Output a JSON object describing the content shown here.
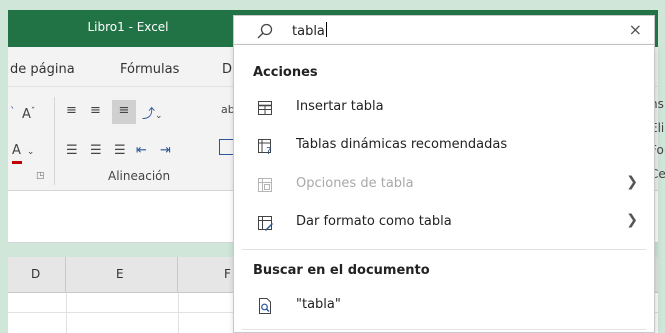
{
  "window": {
    "title": "Libro1  -  Excel"
  },
  "ribbon": {
    "tabs": [
      "de página",
      "Fórmulas",
      "D"
    ],
    "alignment_group_label": "Alineación",
    "right_cut_texts": [
      "ns",
      "Elir",
      "For",
      "Ce"
    ],
    "wrap_text_fragment": "ab"
  },
  "columns": [
    "D",
    "E",
    "F"
  ],
  "search": {
    "value": "tabla",
    "close_glyph": "×",
    "sections": {
      "actions_title": "Acciones",
      "document_title": "Buscar en el documento"
    },
    "actions": [
      {
        "label": "Insertar tabla",
        "icon": "insert-table-icon",
        "enabled": true,
        "submenu": false
      },
      {
        "label": "Tablas dinámicas recomendadas",
        "icon": "recommended-pivot-icon",
        "enabled": true,
        "submenu": false
      },
      {
        "label": "Opciones de tabla",
        "icon": "table-options-icon",
        "enabled": false,
        "submenu": true
      },
      {
        "label": "Dar formato como tabla",
        "icon": "format-as-table-icon",
        "enabled": true,
        "submenu": true
      }
    ],
    "document_results": [
      {
        "label": "\"tabla\"",
        "icon": "search-document-icon"
      }
    ]
  },
  "colors": {
    "excel_green": "#217346",
    "background": "#cfe6d9",
    "accent_red": "#c00000",
    "accent_blue": "#2b579a"
  }
}
